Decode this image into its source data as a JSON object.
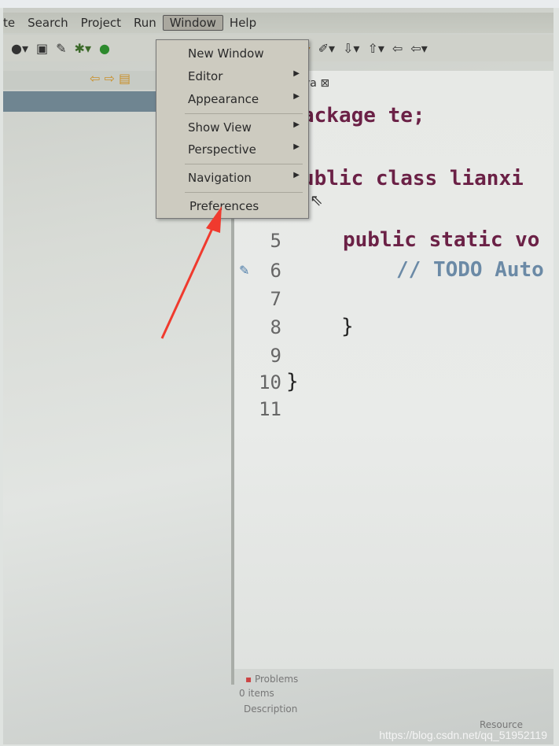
{
  "menubar": {
    "items": [
      "te",
      "Search",
      "Project",
      "Run",
      "Window",
      "Help"
    ]
  },
  "editor": {
    "tab": "va",
    "close_icon": "close-icon",
    "lines": [
      {
        "num": "",
        "text": "ackage te;"
      },
      {
        "num": "",
        "text": "ublic class lianxi"
      },
      {
        "num": "5",
        "text": "public static vo"
      },
      {
        "num": "6",
        "text": "// TODO Auto"
      },
      {
        "num": "7",
        "text": ""
      },
      {
        "num": "8",
        "text": "}"
      },
      {
        "num": "9",
        "text": ""
      },
      {
        "num": "10",
        "text": "}"
      },
      {
        "num": "11",
        "text": ""
      }
    ]
  },
  "window_menu": {
    "items": [
      {
        "label": "New Window",
        "submenu": false
      },
      {
        "label": "Editor",
        "submenu": true
      },
      {
        "label": "Appearance",
        "submenu": true
      },
      {
        "label": "Show View",
        "submenu": true
      },
      {
        "label": "Perspective",
        "submenu": true
      },
      {
        "label": "Navigation",
        "submenu": true
      },
      {
        "label": "Preferences",
        "submenu": false
      }
    ]
  },
  "problems": {
    "title": "Problems",
    "count": "0 items",
    "col_description": "Description",
    "col_resource": "Resource"
  },
  "watermark": "https://blog.csdn.net/qq_51952119",
  "colors": {
    "arrow": "#f03a2e",
    "keyword": "#6b2146"
  }
}
